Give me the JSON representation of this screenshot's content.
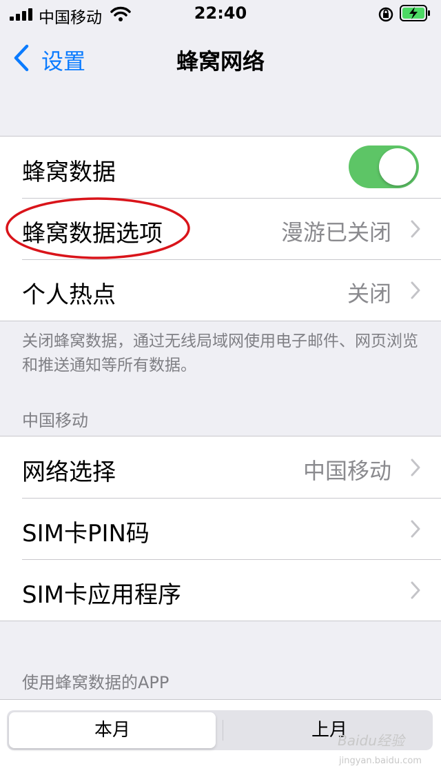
{
  "status_bar": {
    "carrier": "中国移动",
    "time": "22:40"
  },
  "nav": {
    "back_label": "设置",
    "title": "蜂窝网络"
  },
  "group1": {
    "cellular_data_label": "蜂窝数据",
    "cellular_data_on": true,
    "cellular_options_label": "蜂窝数据选项",
    "cellular_options_value": "漫游已关闭",
    "hotspot_label": "个人热点",
    "hotspot_value": "关闭"
  },
  "footer_note": "关闭蜂窝数据，通过无线局域网使用电子邮件、网页浏览和推送通知等所有数据。",
  "section_carrier": "中国移动",
  "group2": {
    "network_label": "网络选择",
    "network_value": "中国移动",
    "sim_pin_label": "SIM卡PIN码",
    "sim_apps_label": "SIM卡应用程序"
  },
  "section_apps": "使用蜂窝数据的APP",
  "segment": {
    "current": "本月",
    "previous": "上月"
  },
  "watermark": {
    "text": "Baidu经验",
    "sub": "jingyan.baidu.com"
  },
  "colors": {
    "accent": "#0a7bff",
    "toggle_on": "#5dc566",
    "annotation": "#d9141a"
  }
}
